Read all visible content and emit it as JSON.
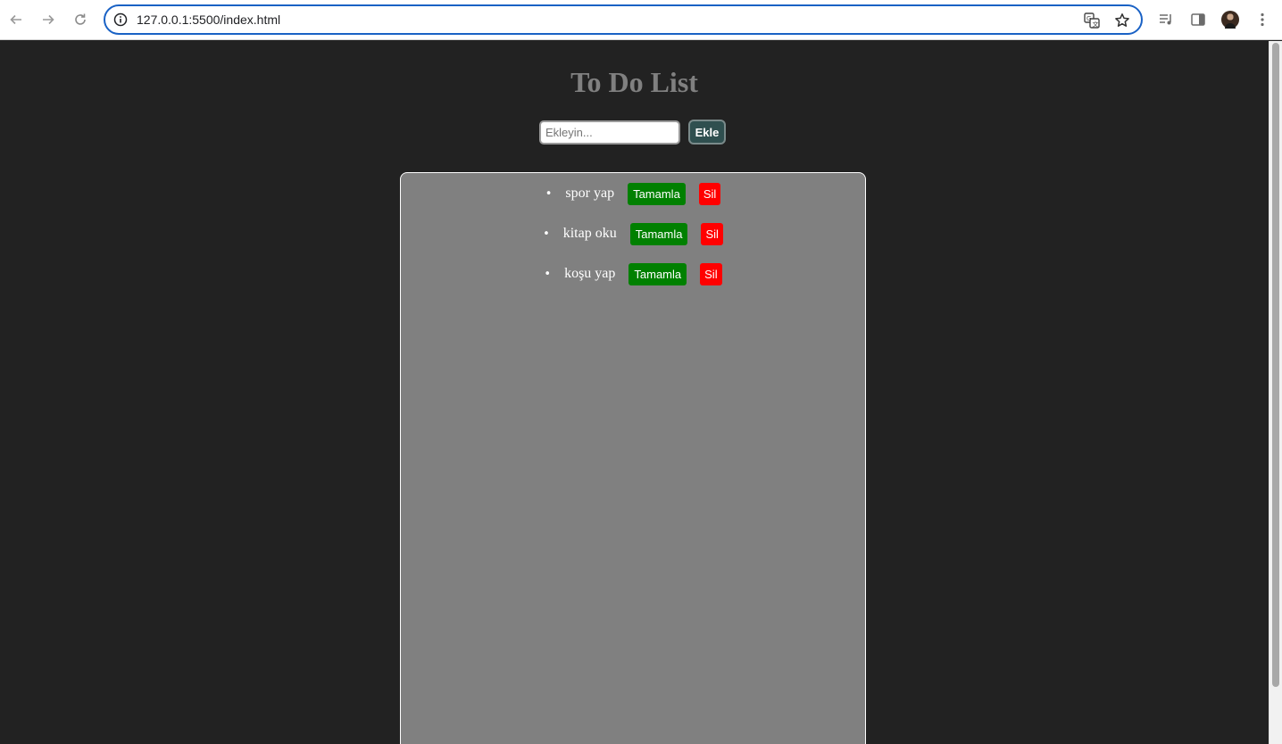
{
  "browser": {
    "url": "127.0.0.1:5500/index.html",
    "icons": {
      "back": "arrow-left-icon",
      "forward": "arrow-right-icon",
      "reload": "reload-icon",
      "site_info": "info-icon",
      "translate": "translate-icon",
      "bookmark": "star-icon",
      "media": "media-queue-icon",
      "side_panel": "side-panel-icon",
      "profile": "avatar",
      "menu": "kebab-menu-icon"
    }
  },
  "page": {
    "title": "To Do List",
    "input_placeholder": "Ekleyin...",
    "add_button": "Ekle",
    "items": [
      {
        "text": "spor yap",
        "complete_label": "Tamamla",
        "delete_label": "Sil"
      },
      {
        "text": "kitap oku",
        "complete_label": "Tamamla",
        "delete_label": "Sil"
      },
      {
        "text": "koşu yap",
        "complete_label": "Tamamla",
        "delete_label": "Sil"
      }
    ]
  },
  "colors": {
    "page_background": "#222222",
    "title": "#808080",
    "list_background": "#808080",
    "complete_button": "#008000",
    "delete_button": "#ff0000",
    "add_button": "#2f4f4f",
    "omnibox_border": "#1a62c5"
  }
}
